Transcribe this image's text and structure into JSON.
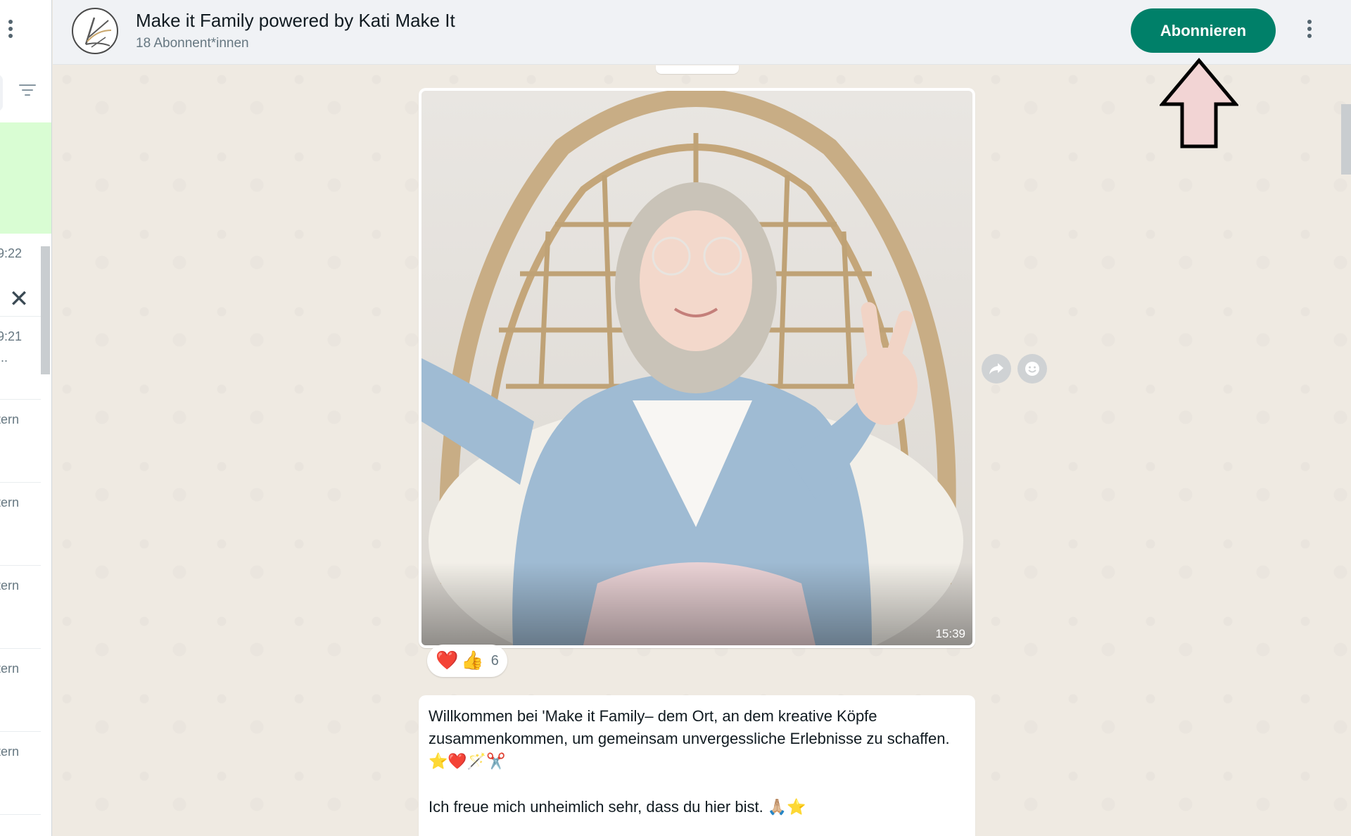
{
  "sidebar": {
    "rows": [
      {
        "time": "9:22",
        "snippet": ""
      },
      {
        "time": "9:21",
        "snippet": "..."
      },
      {
        "time": "tern",
        "snippet": ""
      },
      {
        "time": "tern",
        "snippet": ""
      },
      {
        "time": "tern",
        "snippet": ""
      },
      {
        "time": "tern",
        "snippet": ""
      },
      {
        "time": "tern",
        "snippet": ""
      }
    ]
  },
  "header": {
    "title": "Make it Family powered by Kati Make It",
    "subtitle": "18 Abonnent*innen",
    "subscribe_label": "Abonnieren"
  },
  "image_message": {
    "time": "15:39",
    "reactions": {
      "emojis": [
        "❤️",
        "👍"
      ],
      "count": "6"
    }
  },
  "text_message": {
    "para1": "Willkommen bei 'Make it Family– dem Ort, an dem kreative Köpfe zusammenkommen, um gemeinsam unvergessliche Erlebnisse zu schaffen.",
    "para1_emojis": "⭐❤️🪄✂️",
    "para2": "Ich freue mich unheimlich sehr, dass du hier bist.",
    "para2_emojis": "🙏🏼⭐"
  },
  "colors": {
    "accent": "#008069",
    "chat_bg": "#efeae2",
    "annotation_arrow": "#f2d4d4"
  }
}
